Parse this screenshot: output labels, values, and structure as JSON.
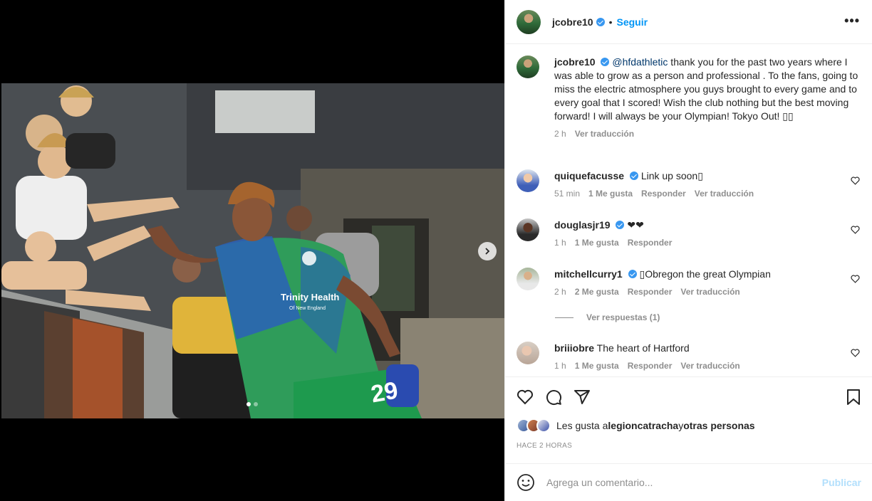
{
  "post": {
    "username": "jcobre10",
    "separator": "•",
    "follow_label": "Seguir",
    "more_label": "•••"
  },
  "caption": {
    "username": "jcobre10",
    "mention": "@hfdathletic",
    "text": " thank you for the past two years where I was able to grow as a person and professional . To the fans, going to miss the electric atmosphere you guys brought to every game and to every goal that I scored! Wish the club nothing but the best moving forward! I will always be your Olympian! Tokyo Out! ▯▯",
    "time": "2 h",
    "translate": "Ver traducción"
  },
  "comments": [
    {
      "username": "quiquefacusse",
      "verified": true,
      "text": "Link up soon▯",
      "time": "51 min",
      "likes": "1 Me gusta",
      "reply": "Responder",
      "translate": "Ver traducción"
    },
    {
      "username": "douglasjr19",
      "verified": true,
      "text": "❤❤",
      "time": "1 h",
      "likes": "1 Me gusta",
      "reply": "Responder",
      "translate": ""
    },
    {
      "username": "mitchellcurry1",
      "verified": true,
      "text": "▯Obregon the great Olympian",
      "time": "2 h",
      "likes": "2 Me gusta",
      "reply": "Responder",
      "translate": "Ver traducción"
    },
    {
      "username": "briiiobre",
      "verified": false,
      "text": "The heart of Hartford",
      "time": "1 h",
      "likes": "1 Me gusta",
      "reply": "Responder",
      "translate": "Ver traducción"
    }
  ],
  "view_replies": "Ver respuestas (1)",
  "likes": {
    "prefix": "Les gusta a ",
    "user": "legioncatracha",
    "middle": " y ",
    "others": "otras personas"
  },
  "timestamp": "HACE 2 HORAS",
  "add_comment": {
    "placeholder": "Agrega un comentario...",
    "publish_label": "Publicar"
  },
  "photo": {
    "jersey_number": "29",
    "sponsor": "Trinity Health",
    "sponsor_sub": "Of New England"
  },
  "colors": {
    "link": "#0095f6",
    "verified": "#3897f0",
    "muted": "#8e8e8e",
    "publish_disabled": "#b2dffc"
  },
  "icons": [
    "chevron-right-icon",
    "heart-icon",
    "comment-icon",
    "share-icon",
    "bookmark-icon",
    "emoji-icon",
    "verified-icon",
    "more-icon"
  ]
}
